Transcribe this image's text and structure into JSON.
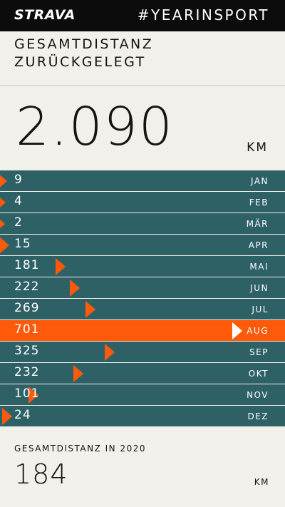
{
  "header": {
    "brand": "STRAVA",
    "hashtag": "#YEARINSPORT"
  },
  "headline": {
    "line1": "GESAMTDISTANZ",
    "line2": "ZURÜCKGELEGT"
  },
  "total": {
    "value": "2.090",
    "unit": "KM"
  },
  "months": [
    {
      "label": "JAN",
      "value": "9",
      "highlight": false
    },
    {
      "label": "FEB",
      "value": "4",
      "highlight": false
    },
    {
      "label": "MÄR",
      "value": "2",
      "highlight": false
    },
    {
      "label": "APR",
      "value": "15",
      "highlight": false
    },
    {
      "label": "MAI",
      "value": "181",
      "highlight": false
    },
    {
      "label": "JUN",
      "value": "222",
      "highlight": false
    },
    {
      "label": "JUL",
      "value": "269",
      "highlight": false
    },
    {
      "label": "AUG",
      "value": "701",
      "highlight": true
    },
    {
      "label": "SEP",
      "value": "325",
      "highlight": false
    },
    {
      "label": "OKT",
      "value": "232",
      "highlight": false
    },
    {
      "label": "NOV",
      "value": "101",
      "highlight": false
    },
    {
      "label": "DEZ",
      "value": "24",
      "highlight": false
    }
  ],
  "footer": {
    "label": "GESAMTDISTANZ IN 2020",
    "value": "184",
    "unit": "KM"
  },
  "colors": {
    "background": "#f2f0eb",
    "topbar": "#0c0c0c",
    "row": "#2e6166",
    "accent": "#ff5a0a"
  }
}
